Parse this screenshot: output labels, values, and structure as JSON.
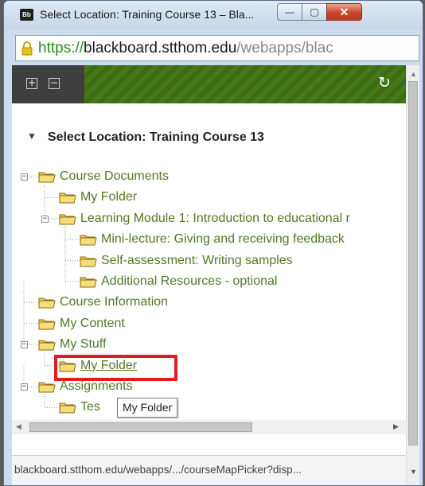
{
  "window": {
    "title": "Select Location: Training Course 13 – Bla...",
    "app_icon_text": "Bb",
    "buttons": {
      "minimize": "—",
      "maximize": "▢",
      "close": "✕"
    }
  },
  "address": {
    "scheme": "https://",
    "host": "blackboard.stthom.edu",
    "path": "/webapps/blac"
  },
  "toolbar": {
    "expand_icon": "plus-square-icon",
    "collapse_icon": "minus-square-icon",
    "refresh_icon": "refresh-icon",
    "expand_glyph": "+",
    "collapse_glyph": "−",
    "refresh_glyph": "↻"
  },
  "heading": "Select Location: Training Course 13",
  "tree": [
    {
      "label": "Course Documents",
      "depth": 0,
      "expanded": true
    },
    {
      "label": "My Folder",
      "depth": 1
    },
    {
      "label": "Learning Module 1: Introduction to educational r",
      "depth": 1,
      "expanded": true
    },
    {
      "label": "Mini-lecture: Giving and receiving feedback",
      "depth": 2
    },
    {
      "label": "Self-assessment: Writing samples",
      "depth": 2
    },
    {
      "label": "Additional Resources - optional",
      "depth": 2
    },
    {
      "label": "Course Information",
      "depth": 0
    },
    {
      "label": "My Content",
      "depth": 0
    },
    {
      "label": "My Stuff",
      "depth": 0,
      "expanded": true
    },
    {
      "label": "My Folder",
      "depth": 1,
      "highlighted": true
    },
    {
      "label": "Assignments",
      "depth": 0,
      "expanded": true
    },
    {
      "label": "Tes",
      "depth": 1
    }
  ],
  "tooltip": "My Folder",
  "status_bar": "blackboard.stthom.edu/webapps/.../courseMapPicker?disp...",
  "colors": {
    "tree_text": "#4f7a26",
    "highlight_border": "#e31b1b",
    "toolbar_green": "#467a18"
  }
}
